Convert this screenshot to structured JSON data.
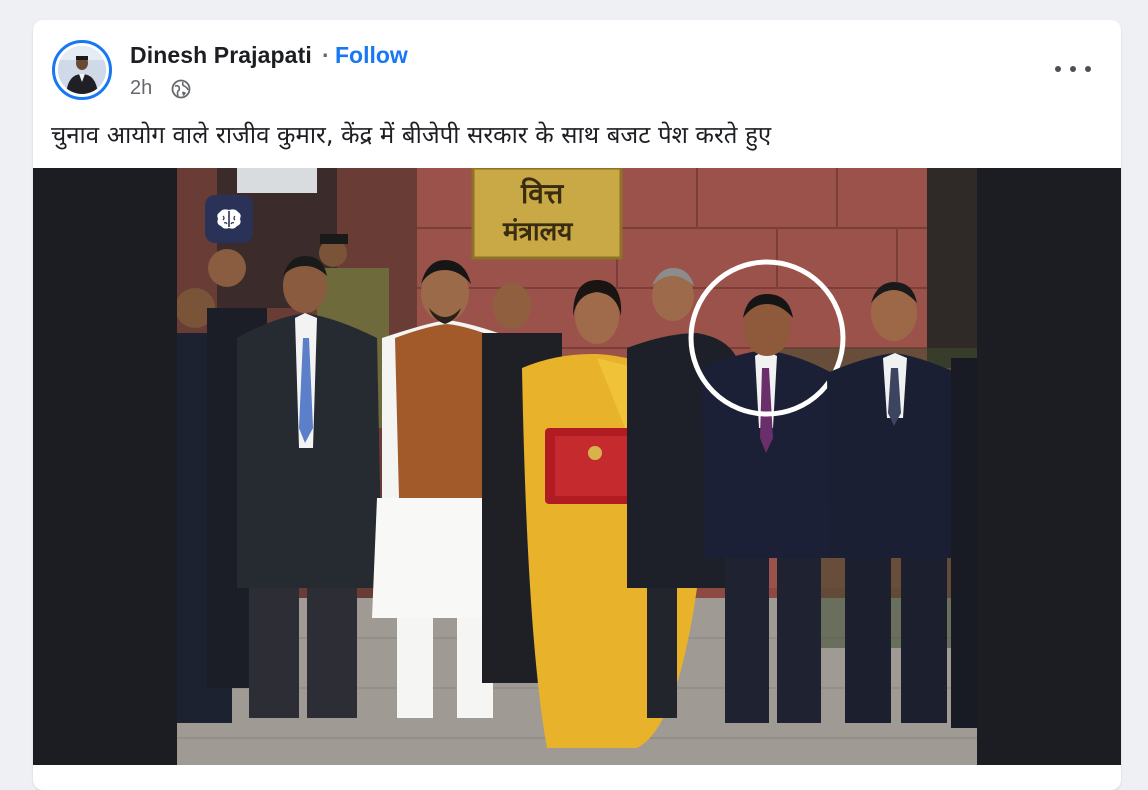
{
  "post": {
    "author": "Dinesh Prajapati",
    "separator": "·",
    "follow_label": "Follow",
    "timestamp": "2h",
    "privacy_icon": "globe-icon",
    "more_icon": "more-options-icon",
    "caption": "चुनाव आयोग वाले राजीव कुमार, केंद्र में बीजेपी सरकार के साथ बजट पेश करते हुए"
  },
  "photo": {
    "plaque_line1": "वित्त",
    "plaque_line2": "मंत्रालय",
    "badge_icon": "brain-icon"
  },
  "colors": {
    "accent": "#1877f2",
    "card": "#ffffff",
    "page": "#eef0f4",
    "media_bg": "#1c1c23"
  }
}
